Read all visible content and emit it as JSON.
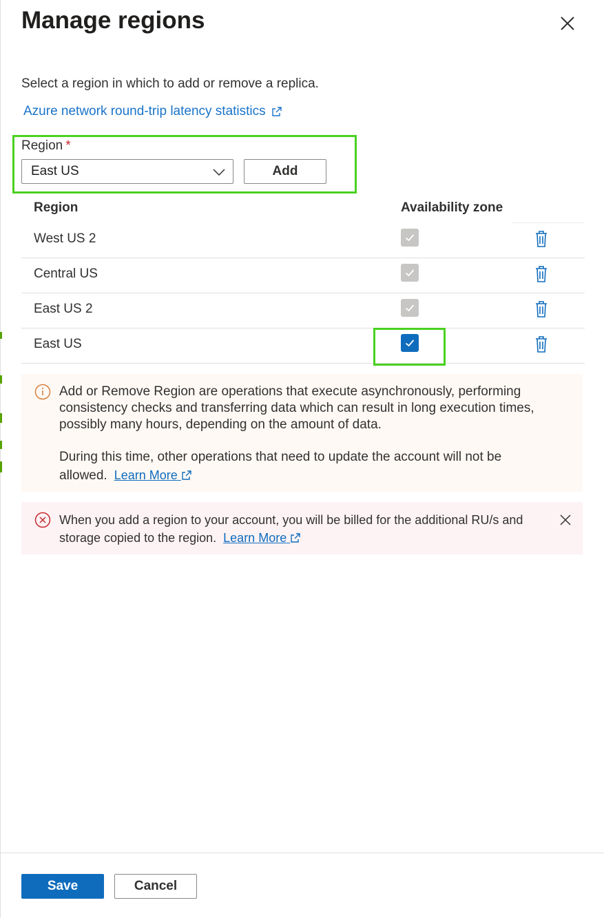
{
  "panel": {
    "title": "Manage regions",
    "intro": "Select a region in which to add or remove a replica.",
    "latency_link": "Azure network round-trip latency statistics"
  },
  "region_picker": {
    "label": "Region",
    "required_mark": "*",
    "selected": "East US",
    "add_label": "Add"
  },
  "table": {
    "headers": {
      "region": "Region",
      "zone": "Availability zone"
    },
    "rows": [
      {
        "name": "West US 2",
        "zone_checked": true,
        "zone_enabled": false
      },
      {
        "name": "Central US",
        "zone_checked": true,
        "zone_enabled": false
      },
      {
        "name": "East US 2",
        "zone_checked": true,
        "zone_enabled": false
      },
      {
        "name": "East US",
        "zone_checked": true,
        "zone_enabled": true
      }
    ]
  },
  "warning": {
    "text1": "Add or Remove Region are operations that execute asynchronously, performing consistency checks and transferring data which can result in long execution times, possibly many hours, depending on the amount of data.",
    "text2": "During this time, other operations that need to update the account will not be allowed.",
    "link": "Learn More"
  },
  "error": {
    "text": "When you add a region to your account, you will be billed for the additional RU/s and storage copied to the region.",
    "link": "Learn More"
  },
  "footer": {
    "save_label": "Save",
    "cancel_label": "Cancel"
  },
  "colors": {
    "primary": "#0f6cbd",
    "highlight": "#49d11f",
    "warning_bg": "#fff9f5",
    "error_bg": "#fdf3f4",
    "warning_icon": "#d67f3c",
    "error_icon": "#c5282e"
  },
  "icons": {
    "close": "close-icon",
    "external": "external-link-icon",
    "chevron": "chevron-down-icon",
    "delete": "trash-icon",
    "info": "info-icon",
    "error": "error-circle-icon"
  }
}
